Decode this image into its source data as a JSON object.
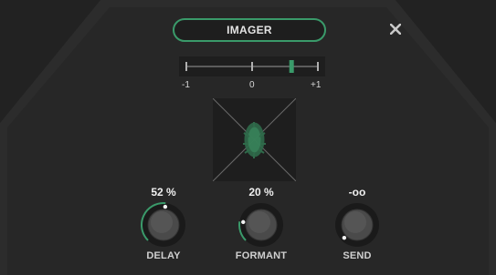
{
  "title": "IMAGER",
  "close_icon": "close-icon",
  "slider": {
    "labels": {
      "min": "-1",
      "mid": "0",
      "max": "+1"
    },
    "value": 0.6
  },
  "stereo_view": {
    "icon": "stereo-field-icon"
  },
  "knobs": {
    "delay": {
      "label": "DELAY",
      "value": "52 %",
      "level": 0.52
    },
    "formant": {
      "label": "FORMANT",
      "value": "20 %",
      "level": 0.2
    },
    "send": {
      "label": "SEND",
      "value": "-oo",
      "level": 0.0
    }
  },
  "colors": {
    "accent": "#3a9a6a",
    "background": "#262626",
    "display": "#1e1e1e"
  }
}
